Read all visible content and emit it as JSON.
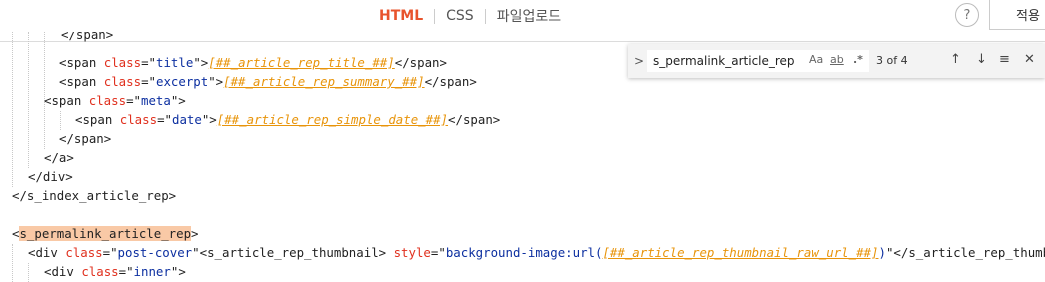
{
  "tabs": [
    {
      "label": "HTML",
      "active": true
    },
    {
      "label": "CSS",
      "active": false
    },
    {
      "label": "파일업로드",
      "active": false
    }
  ],
  "help_label": "?",
  "apply_label": "적용",
  "find": {
    "toggle_icon": ">",
    "query": "s_permalink_article_rep",
    "match_case_label": "Aa",
    "whole_word_label": "ab",
    "regex_label": ".*",
    "count": "3 of 4",
    "prev_icon": "↑",
    "next_icon": "↓",
    "selection_icon": "≡",
    "close_icon": "✕"
  },
  "code_lines": [
    {
      "parts": [
        {
          "t": "</span>",
          "c": "tag"
        }
      ]
    },
    {
      "parts": [
        {
          "t": "<span ",
          "c": "tag"
        },
        {
          "t": "class",
          "c": "attr"
        },
        {
          "t": "=\"",
          "c": "tag"
        },
        {
          "t": "title",
          "c": "val"
        },
        {
          "t": "\">",
          "c": "tag"
        },
        {
          "t": "[##_article_rep_title_##]",
          "c": "tmpl"
        },
        {
          "t": "</span>",
          "c": "tag"
        }
      ]
    },
    {
      "parts": [
        {
          "t": "<span ",
          "c": "tag"
        },
        {
          "t": "class",
          "c": "attr"
        },
        {
          "t": "=\"",
          "c": "tag"
        },
        {
          "t": "excerpt",
          "c": "val"
        },
        {
          "t": "\">",
          "c": "tag"
        },
        {
          "t": "[##_article_rep_summary_##]",
          "c": "tmpl"
        },
        {
          "t": "</span>",
          "c": "tag"
        }
      ]
    },
    {
      "parts": [
        {
          "t": "<span ",
          "c": "tag"
        },
        {
          "t": "class",
          "c": "attr"
        },
        {
          "t": "=\"",
          "c": "tag"
        },
        {
          "t": "meta",
          "c": "val"
        },
        {
          "t": "\">",
          "c": "tag"
        }
      ]
    },
    {
      "parts": [
        {
          "t": "<span ",
          "c": "tag"
        },
        {
          "t": "class",
          "c": "attr"
        },
        {
          "t": "=\"",
          "c": "tag"
        },
        {
          "t": "date",
          "c": "val"
        },
        {
          "t": "\">",
          "c": "tag"
        },
        {
          "t": "[##_article_rep_simple_date_##]",
          "c": "tmpl"
        },
        {
          "t": "</span>",
          "c": "tag"
        }
      ]
    },
    {
      "parts": [
        {
          "t": "</span>",
          "c": "tag"
        }
      ]
    },
    {
      "parts": [
        {
          "t": "</a>",
          "c": "tag"
        }
      ]
    },
    {
      "parts": [
        {
          "t": "</div>",
          "c": "tag"
        }
      ]
    },
    {
      "parts": [
        {
          "t": "</s_index_article_rep>",
          "c": "tag"
        }
      ]
    },
    {
      "parts": []
    },
    {
      "parts": [
        {
          "t": "<",
          "c": "tag"
        },
        {
          "t": "s_permalink_article_rep",
          "c": "hl"
        },
        {
          "t": ">",
          "c": "tag"
        }
      ]
    },
    {
      "parts": [
        {
          "t": "<div ",
          "c": "tag"
        },
        {
          "t": "class",
          "c": "attr"
        },
        {
          "t": "=\"",
          "c": "tag"
        },
        {
          "t": "post-cover",
          "c": "val"
        },
        {
          "t": "\"<s_article_rep_thumbnail> ",
          "c": "tag"
        },
        {
          "t": "style",
          "c": "attr"
        },
        {
          "t": "=\"",
          "c": "tag"
        },
        {
          "t": "background-image:url(",
          "c": "val"
        },
        {
          "t": "[##_article_rep_thumbnail_raw_url_##]",
          "c": "tmpl"
        },
        {
          "t": ")",
          "c": "val"
        },
        {
          "t": "\"</s_article_rep_thumbnail>",
          "c": "tag"
        }
      ]
    },
    {
      "parts": [
        {
          "t": "<div ",
          "c": "tag"
        },
        {
          "t": "class",
          "c": "attr"
        },
        {
          "t": "=\"",
          "c": "tag"
        },
        {
          "t": "inner",
          "c": "val"
        },
        {
          "t": "\">",
          "c": "tag"
        }
      ]
    }
  ]
}
